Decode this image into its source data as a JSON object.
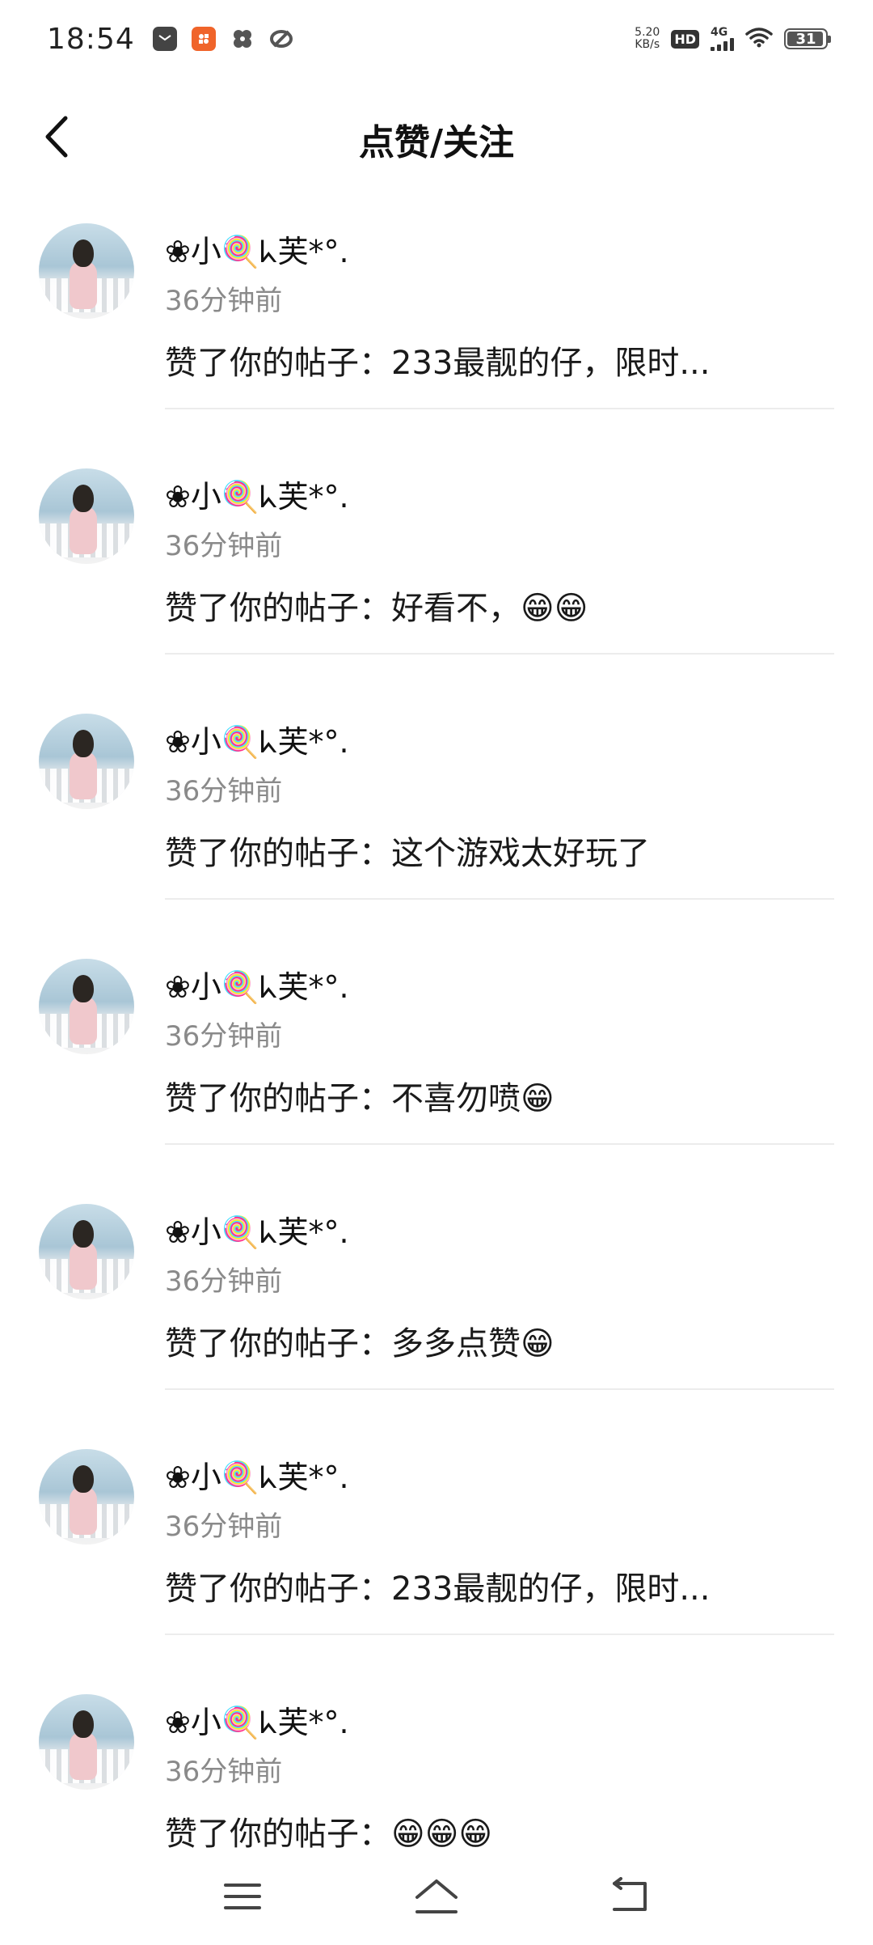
{
  "status_bar": {
    "time": "18:54",
    "net_speed_value": "5.20",
    "net_speed_unit": "KB/s",
    "hd_label": "HD",
    "network_type": "4G",
    "battery_level": "31"
  },
  "header": {
    "title": "点赞/关注"
  },
  "notifications": [
    {
      "username": "❀小🍭ᖾ芙*°.",
      "time": "36分钟前",
      "text": "赞了你的帖子：233最靓的仔，限时..."
    },
    {
      "username": "❀小🍭ᖾ芙*°.",
      "time": "36分钟前",
      "text": "赞了你的帖子：好看不，😁😁"
    },
    {
      "username": "❀小🍭ᖾ芙*°.",
      "time": "36分钟前",
      "text": "赞了你的帖子：这个游戏太好玩了"
    },
    {
      "username": "❀小🍭ᖾ芙*°.",
      "time": "36分钟前",
      "text": "赞了你的帖子：不喜勿喷😁"
    },
    {
      "username": "❀小🍭ᖾ芙*°.",
      "time": "36分钟前",
      "text": "赞了你的帖子：多多点赞😁"
    },
    {
      "username": "❀小🍭ᖾ芙*°.",
      "time": "36分钟前",
      "text": "赞了你的帖子：233最靓的仔，限时..."
    },
    {
      "username": "❀小🍭ᖾ芙*°.",
      "time": "36分钟前",
      "text": "赞了你的帖子：😁😁😁"
    }
  ],
  "colors": {
    "accent_app_icon": "#f0642a",
    "text_primary": "#1a1a1a",
    "text_secondary": "#8a8a8a",
    "divider": "#ececec"
  },
  "icons": {
    "back": "chevron-left-icon",
    "menu": "menu-icon",
    "home": "home-icon",
    "recent": "back-arrow-icon"
  }
}
